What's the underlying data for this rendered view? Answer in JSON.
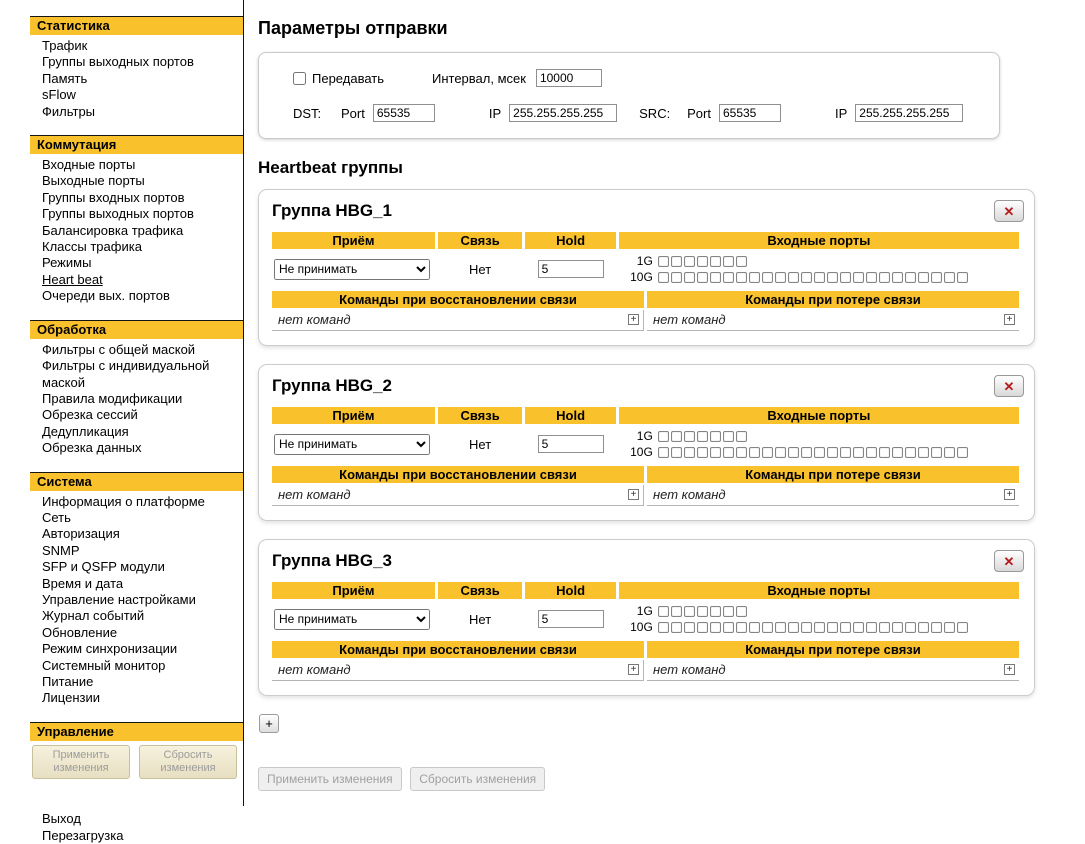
{
  "colors": {
    "accent": "#F9C22D",
    "close_x": "#B51A1A"
  },
  "sidebar": {
    "active_item": "Heart beat",
    "sections": [
      {
        "title": "Статистика",
        "items": [
          "Трафик",
          "Группы выходных портов",
          "Память",
          "sFlow",
          "Фильтры"
        ]
      },
      {
        "title": "Коммутация",
        "items": [
          "Входные порты",
          "Выходные порты",
          "Группы входных портов",
          "Группы выходных портов",
          "Балансировка трафика",
          "Классы трафика",
          "Режимы",
          "Heart beat",
          "Очереди вых. портов"
        ]
      },
      {
        "title": "Обработка",
        "items": [
          "Фильтры с общей маской",
          "Фильтры с индивидуальной маской",
          "Правила модификации",
          "Обрезка сессий",
          "Дедупликация",
          "Обрезка данных"
        ]
      },
      {
        "title": "Система",
        "items": [
          "Информация о платформе",
          "Сеть",
          "Авторизация",
          "SNMP",
          "SFP и QSFP модули",
          "Время и дата",
          "Управление настройками",
          "Журнал событий",
          "Обновление",
          "Режим синхронизации",
          "Системный монитор",
          "Питание",
          "Лицензии"
        ]
      },
      {
        "title": "Управление",
        "items": []
      }
    ],
    "apply_button": "Применить изменения",
    "reset_button": "Сбросить изменения",
    "logout_link": "Выход",
    "reboot_link": "Перезагрузка"
  },
  "send_params": {
    "title": "Параметры отправки",
    "transmit_label": "Передавать",
    "interval_label": "Интервал, мсек",
    "interval_value": "10000",
    "dst_label": "DST:",
    "src_label": "SRC:",
    "port_label": "Port",
    "ip_label": "IP",
    "dst_port": "65535",
    "dst_ip": "255.255.255.255",
    "src_port": "65535",
    "src_ip": "255.255.255.255"
  },
  "heartbeat": {
    "title": "Heartbeat группы",
    "columns": {
      "receive": "Приём",
      "link": "Связь",
      "hold": "Hold",
      "input_ports": "Входные порты",
      "restore_commands": "Команды при восстановлении связи",
      "loss_commands": "Команды при потере связи"
    },
    "port_rows": [
      {
        "label": "1G",
        "count": 7
      },
      {
        "label": "10G",
        "count": 24
      }
    ],
    "groups": [
      {
        "name": "Группа HBG_1",
        "receive_mode": "Не принимать",
        "link_state": "Нет",
        "hold": "5",
        "restore_commands": "нет команд",
        "loss_commands": "нет команд"
      },
      {
        "name": "Группа HBG_2",
        "receive_mode": "Не принимать",
        "link_state": "Нет",
        "hold": "5",
        "restore_commands": "нет команд",
        "loss_commands": "нет команд"
      },
      {
        "name": "Группа HBG_3",
        "receive_mode": "Не принимать",
        "link_state": "Нет",
        "hold": "5",
        "restore_commands": "нет команд",
        "loss_commands": "нет команд"
      }
    ],
    "close_button": "✕",
    "add_button": "+"
  },
  "footer": {
    "apply_button": "Применить изменения",
    "reset_button": "Сбросить изменения"
  }
}
